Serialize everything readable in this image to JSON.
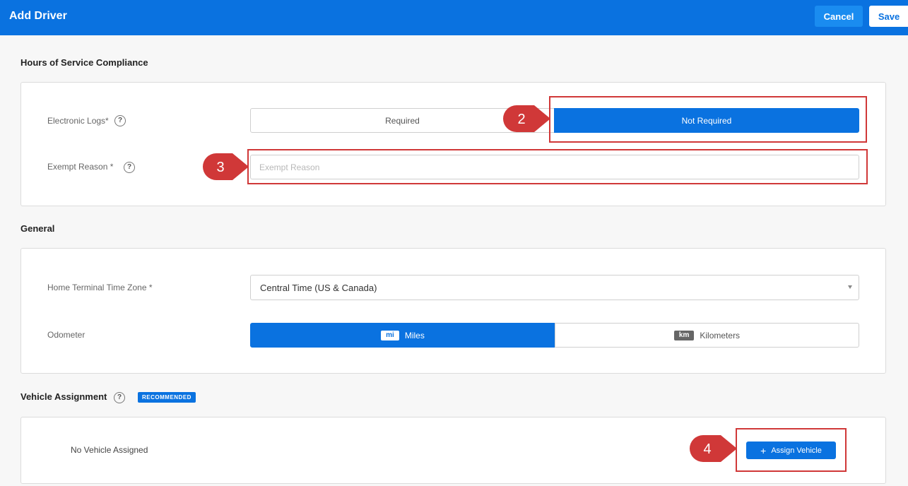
{
  "header": {
    "title": "Add Driver",
    "cancel_label": "Cancel",
    "save_label": "Save"
  },
  "hos": {
    "section_title": "Hours of Service Compliance",
    "electronic_logs": {
      "label": "Electronic Logs*",
      "option_required": "Required",
      "option_not_required": "Not Required",
      "selected": "Not Required"
    },
    "exempt_reason": {
      "label": "Exempt Reason *",
      "placeholder": "Exempt Reason",
      "value": ""
    }
  },
  "general": {
    "section_title": "General",
    "time_zone": {
      "label": "Home Terminal Time Zone *",
      "value": "Central Time (US & Canada)"
    },
    "odometer": {
      "label": "Odometer",
      "miles_badge": "mi",
      "miles_label": "Miles",
      "km_badge": "km",
      "km_label": "Kilometers",
      "selected": "Miles"
    }
  },
  "vehicle": {
    "section_title": "Vehicle Assignment",
    "badge": "RECOMMENDED",
    "empty_text": "No Vehicle Assigned",
    "assign_label": "Assign Vehicle"
  },
  "callouts": {
    "step2": "2",
    "step3": "3",
    "step4": "4"
  },
  "colors": {
    "accent": "#0a72e0",
    "callout": "#d03838"
  }
}
